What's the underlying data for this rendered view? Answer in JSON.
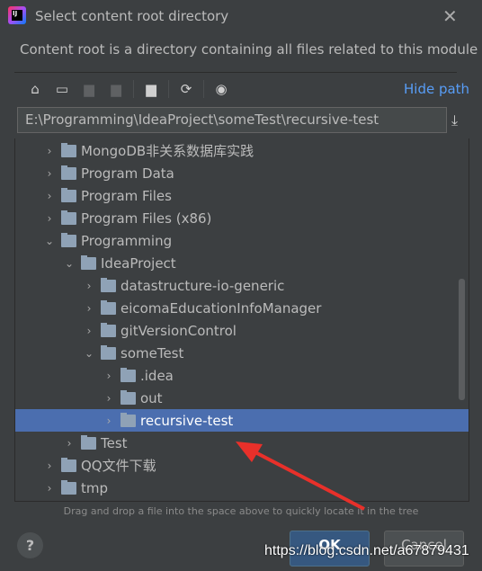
{
  "dialog": {
    "title": "Select content root directory",
    "description": "Content root is a directory containing all files related to this module",
    "logo": "IJ"
  },
  "toolbar": {
    "icons": [
      "home-icon",
      "desktop-icon",
      "project-folder-icon",
      "module-folder-icon",
      "new-folder-icon",
      "refresh-icon",
      "show-hidden-icon"
    ],
    "hide_path": "Hide path"
  },
  "path": {
    "value": "E:\\Programming\\IdeaProject\\someTest\\recursive-test"
  },
  "tree": [
    {
      "label": "MongoDB非关系数据库实践",
      "level": 0,
      "expanded": false
    },
    {
      "label": "Program Data",
      "level": 0,
      "expanded": false
    },
    {
      "label": "Program Files",
      "level": 0,
      "expanded": false
    },
    {
      "label": "Program Files (x86)",
      "level": 0,
      "expanded": false
    },
    {
      "label": "Programming",
      "level": 0,
      "expanded": true
    },
    {
      "label": "IdeaProject",
      "level": 1,
      "expanded": true
    },
    {
      "label": "datastructure-io-generic",
      "level": 2,
      "expanded": false
    },
    {
      "label": "eicomaEducationInfoManager",
      "level": 2,
      "expanded": false
    },
    {
      "label": "gitVersionControl",
      "level": 2,
      "expanded": false
    },
    {
      "label": "someTest",
      "level": 2,
      "expanded": true
    },
    {
      "label": ".idea",
      "level": 3,
      "expanded": false
    },
    {
      "label": "out",
      "level": 3,
      "expanded": false
    },
    {
      "label": "recursive-test",
      "level": 3,
      "expanded": false,
      "selected": true
    },
    {
      "label": "Test",
      "level": 1,
      "expanded": false
    },
    {
      "label": "QQ文件下载",
      "level": 0,
      "expanded": false
    },
    {
      "label": "tmp",
      "level": 0,
      "expanded": false
    }
  ],
  "hint": "Drag and drop a file into the space above to quickly locate it in the tree",
  "buttons": {
    "help": "?",
    "ok": "OK",
    "cancel": "Cancel"
  },
  "watermark": "https://blog.csdn.net/a67879431",
  "colors": {
    "selection": "#4b6eaf",
    "link": "#589df6",
    "annotation_arrow": "#e8302a"
  }
}
